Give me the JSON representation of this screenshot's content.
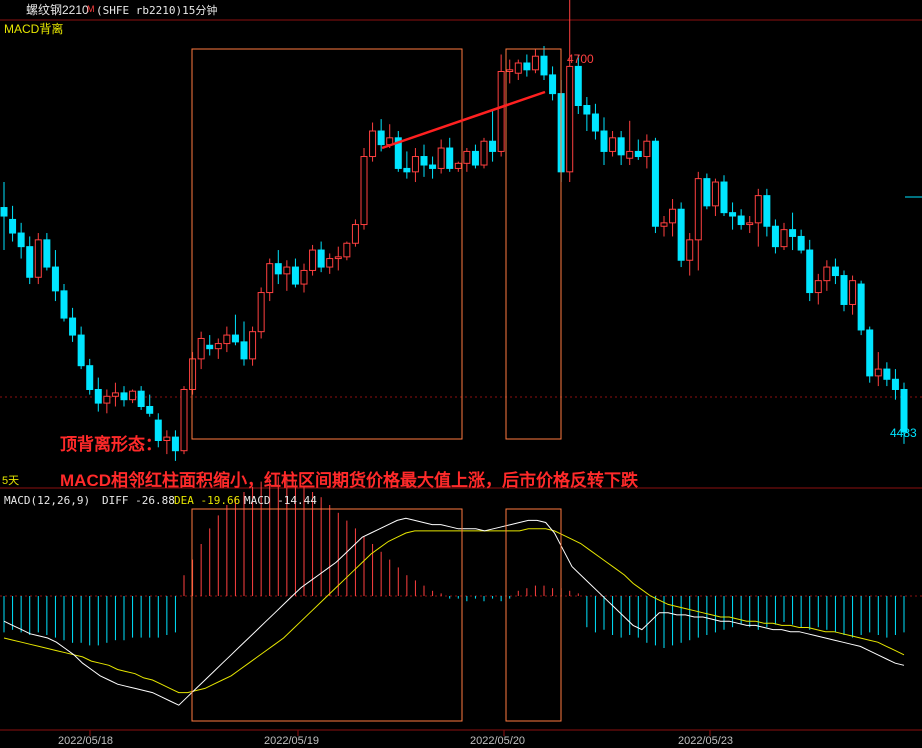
{
  "header": {
    "instrument": "螺纹钢2210",
    "flag": "M",
    "info": "(SHFE rb2210)15分钟"
  },
  "price_panel": {
    "indicator_title": "MACD背离",
    "period_label": "5天",
    "high_label": "4700",
    "last_label": "4483"
  },
  "macd_panel": {
    "title": "MACD(12,26,9)",
    "diff_label": "DIFF -26.88",
    "dea_label": "DEA -19.66",
    "macd_label": "MACD -14.44"
  },
  "annotation": {
    "line1": "顶背离形态：",
    "line2": "MACD相邻红柱面积缩小，红柱区间期货价格最大值上涨，后市价格反转下跌"
  },
  "colors": {
    "up": "#ff4040",
    "down": "#00e5ff",
    "box": "#ff7a40",
    "diff": "#ffffff",
    "dea": "#e6e600",
    "divergence_line": "#ff2020",
    "grid": "#8b1010"
  },
  "chart_data": {
    "type": "candlestick",
    "x_ticks": [
      "2022/05/18",
      "2022/05/19",
      "2022/05/20",
      "2022/05/23"
    ],
    "price_high": 4700,
    "price_last": 4483,
    "candles": [
      {
        "o": 4615,
        "h": 4630,
        "l": 4590,
        "c": 4610
      },
      {
        "o": 4608,
        "h": 4616,
        "l": 4595,
        "c": 4600
      },
      {
        "o": 4600,
        "h": 4606,
        "l": 4585,
        "c": 4592
      },
      {
        "o": 4592,
        "h": 4598,
        "l": 4570,
        "c": 4574
      },
      {
        "o": 4574,
        "h": 4600,
        "l": 4570,
        "c": 4596
      },
      {
        "o": 4596,
        "h": 4600,
        "l": 4578,
        "c": 4580
      },
      {
        "o": 4580,
        "h": 4590,
        "l": 4560,
        "c": 4566
      },
      {
        "o": 4566,
        "h": 4570,
        "l": 4548,
        "c": 4550
      },
      {
        "o": 4550,
        "h": 4556,
        "l": 4536,
        "c": 4540
      },
      {
        "o": 4540,
        "h": 4545,
        "l": 4520,
        "c": 4522
      },
      {
        "o": 4522,
        "h": 4526,
        "l": 4505,
        "c": 4508
      },
      {
        "o": 4508,
        "h": 4515,
        "l": 4495,
        "c": 4500
      },
      {
        "o": 4500,
        "h": 4508,
        "l": 4494,
        "c": 4504
      },
      {
        "o": 4504,
        "h": 4512,
        "l": 4498,
        "c": 4506
      },
      {
        "o": 4506,
        "h": 4510,
        "l": 4498,
        "c": 4502
      },
      {
        "o": 4502,
        "h": 4508,
        "l": 4500,
        "c": 4507
      },
      {
        "o": 4507,
        "h": 4510,
        "l": 4496,
        "c": 4498
      },
      {
        "o": 4498,
        "h": 4505,
        "l": 4492,
        "c": 4494
      },
      {
        "o": 4490,
        "h": 4494,
        "l": 4474,
        "c": 4478
      },
      {
        "o": 4478,
        "h": 4484,
        "l": 4470,
        "c": 4480
      },
      {
        "o": 4480,
        "h": 4484,
        "l": 4466,
        "c": 4472
      },
      {
        "o": 4472,
        "h": 4510,
        "l": 4470,
        "c": 4508
      },
      {
        "o": 4508,
        "h": 4530,
        "l": 4505,
        "c": 4526
      },
      {
        "o": 4526,
        "h": 4542,
        "l": 4520,
        "c": 4538
      },
      {
        "o": 4534,
        "h": 4540,
        "l": 4528,
        "c": 4532
      },
      {
        "o": 4532,
        "h": 4538,
        "l": 4526,
        "c": 4535
      },
      {
        "o": 4535,
        "h": 4545,
        "l": 4530,
        "c": 4540
      },
      {
        "o": 4540,
        "h": 4552,
        "l": 4534,
        "c": 4536
      },
      {
        "o": 4536,
        "h": 4548,
        "l": 4522,
        "c": 4526
      },
      {
        "o": 4526,
        "h": 4545,
        "l": 4522,
        "c": 4542
      },
      {
        "o": 4542,
        "h": 4568,
        "l": 4538,
        "c": 4565
      },
      {
        "o": 4565,
        "h": 4585,
        "l": 4560,
        "c": 4582
      },
      {
        "o": 4582,
        "h": 4590,
        "l": 4570,
        "c": 4576
      },
      {
        "o": 4576,
        "h": 4584,
        "l": 4566,
        "c": 4580
      },
      {
        "o": 4580,
        "h": 4585,
        "l": 4568,
        "c": 4570
      },
      {
        "o": 4570,
        "h": 4582,
        "l": 4565,
        "c": 4578
      },
      {
        "o": 4578,
        "h": 4593,
        "l": 4575,
        "c": 4590
      },
      {
        "o": 4590,
        "h": 4595,
        "l": 4577,
        "c": 4580
      },
      {
        "o": 4580,
        "h": 4588,
        "l": 4576,
        "c": 4585
      },
      {
        "o": 4585,
        "h": 4592,
        "l": 4578,
        "c": 4586
      },
      {
        "o": 4586,
        "h": 4595,
        "l": 4584,
        "c": 4594
      },
      {
        "o": 4594,
        "h": 4608,
        "l": 4592,
        "c": 4605
      },
      {
        "o": 4605,
        "h": 4650,
        "l": 4602,
        "c": 4645
      },
      {
        "o": 4645,
        "h": 4665,
        "l": 4642,
        "c": 4660
      },
      {
        "o": 4660,
        "h": 4667,
        "l": 4648,
        "c": 4652
      },
      {
        "o": 4652,
        "h": 4664,
        "l": 4650,
        "c": 4656
      },
      {
        "o": 4656,
        "h": 4660,
        "l": 4636,
        "c": 4638
      },
      {
        "o": 4638,
        "h": 4648,
        "l": 4632,
        "c": 4636
      },
      {
        "o": 4636,
        "h": 4650,
        "l": 4630,
        "c": 4645
      },
      {
        "o": 4645,
        "h": 4652,
        "l": 4633,
        "c": 4640
      },
      {
        "o": 4640,
        "h": 4645,
        "l": 4632,
        "c": 4638
      },
      {
        "o": 4638,
        "h": 4655,
        "l": 4635,
        "c": 4650
      },
      {
        "o": 4650,
        "h": 4656,
        "l": 4636,
        "c": 4638
      },
      {
        "o": 4638,
        "h": 4642,
        "l": 4636,
        "c": 4641
      },
      {
        "o": 4641,
        "h": 4650,
        "l": 4636,
        "c": 4648
      },
      {
        "o": 4648,
        "h": 4652,
        "l": 4638,
        "c": 4640
      },
      {
        "o": 4640,
        "h": 4656,
        "l": 4638,
        "c": 4654
      },
      {
        "o": 4654,
        "h": 4672,
        "l": 4642,
        "c": 4648
      },
      {
        "o": 4648,
        "h": 4705,
        "l": 4645,
        "c": 4695
      },
      {
        "o": 4695,
        "h": 4702,
        "l": 4688,
        "c": 4696
      },
      {
        "o": 4694,
        "h": 4702,
        "l": 4690,
        "c": 4700
      },
      {
        "o": 4700,
        "h": 4705,
        "l": 4692,
        "c": 4696
      },
      {
        "o": 4696,
        "h": 4708,
        "l": 4694,
        "c": 4704
      },
      {
        "o": 4704,
        "h": 4710,
        "l": 4690,
        "c": 4693
      },
      {
        "o": 4693,
        "h": 4698,
        "l": 4678,
        "c": 4682
      },
      {
        "o": 4682,
        "h": 4690,
        "l": 4630,
        "c": 4636
      },
      {
        "o": 4636,
        "h": 4740,
        "l": 4630,
        "c": 4698
      },
      {
        "o": 4698,
        "h": 4705,
        "l": 4670,
        "c": 4675
      },
      {
        "o": 4675,
        "h": 4680,
        "l": 4660,
        "c": 4670
      },
      {
        "o": 4670,
        "h": 4676,
        "l": 4655,
        "c": 4660
      },
      {
        "o": 4660,
        "h": 4668,
        "l": 4640,
        "c": 4648
      },
      {
        "o": 4648,
        "h": 4660,
        "l": 4645,
        "c": 4656
      },
      {
        "o": 4656,
        "h": 4660,
        "l": 4640,
        "c": 4646
      },
      {
        "o": 4644,
        "h": 4666,
        "l": 4640,
        "c": 4648
      },
      {
        "o": 4648,
        "h": 4655,
        "l": 4643,
        "c": 4645
      },
      {
        "o": 4645,
        "h": 4658,
        "l": 4638,
        "c": 4654
      },
      {
        "o": 4654,
        "h": 4656,
        "l": 4600,
        "c": 4604
      },
      {
        "o": 4604,
        "h": 4610,
        "l": 4598,
        "c": 4606
      },
      {
        "o": 4606,
        "h": 4620,
        "l": 4598,
        "c": 4614
      },
      {
        "o": 4614,
        "h": 4618,
        "l": 4580,
        "c": 4584
      },
      {
        "o": 4584,
        "h": 4600,
        "l": 4575,
        "c": 4596
      },
      {
        "o": 4596,
        "h": 4636,
        "l": 4578,
        "c": 4632
      },
      {
        "o": 4632,
        "h": 4635,
        "l": 4614,
        "c": 4616
      },
      {
        "o": 4616,
        "h": 4632,
        "l": 4610,
        "c": 4630
      },
      {
        "o": 4630,
        "h": 4634,
        "l": 4610,
        "c": 4612
      },
      {
        "o": 4612,
        "h": 4618,
        "l": 4602,
        "c": 4610
      },
      {
        "o": 4610,
        "h": 4614,
        "l": 4602,
        "c": 4605
      },
      {
        "o": 4605,
        "h": 4610,
        "l": 4600,
        "c": 4606
      },
      {
        "o": 4606,
        "h": 4626,
        "l": 4592,
        "c": 4622
      },
      {
        "o": 4622,
        "h": 4626,
        "l": 4598,
        "c": 4604
      },
      {
        "o": 4604,
        "h": 4608,
        "l": 4588,
        "c": 4592
      },
      {
        "o": 4592,
        "h": 4606,
        "l": 4590,
        "c": 4602
      },
      {
        "o": 4602,
        "h": 4612,
        "l": 4590,
        "c": 4598
      },
      {
        "o": 4598,
        "h": 4602,
        "l": 4588,
        "c": 4590
      },
      {
        "o": 4590,
        "h": 4596,
        "l": 4560,
        "c": 4565
      },
      {
        "o": 4565,
        "h": 4576,
        "l": 4558,
        "c": 4572
      },
      {
        "o": 4572,
        "h": 4584,
        "l": 4566,
        "c": 4580
      },
      {
        "o": 4580,
        "h": 4585,
        "l": 4570,
        "c": 4575
      },
      {
        "o": 4575,
        "h": 4578,
        "l": 4554,
        "c": 4558
      },
      {
        "o": 4558,
        "h": 4575,
        "l": 4552,
        "c": 4572
      },
      {
        "o": 4570,
        "h": 4572,
        "l": 4540,
        "c": 4543
      },
      {
        "o": 4543,
        "h": 4545,
        "l": 4512,
        "c": 4516
      },
      {
        "o": 4516,
        "h": 4530,
        "l": 4510,
        "c": 4520
      },
      {
        "o": 4520,
        "h": 4524,
        "l": 4510,
        "c": 4514
      },
      {
        "o": 4514,
        "h": 4520,
        "l": 4502,
        "c": 4508
      },
      {
        "o": 4508,
        "h": 4512,
        "l": 4476,
        "c": 4483
      }
    ],
    "macd": {
      "x_ticks": [
        "2022/05/18",
        "2022/05/19",
        "2022/05/20",
        "2022/05/23"
      ],
      "diff_last": -26.88,
      "dea_last": -19.66,
      "macd_last": -14.44,
      "histogram": [
        -14,
        -13,
        -14,
        -15,
        -14,
        -15,
        -16,
        -17,
        -18,
        -18,
        -19,
        -19,
        -18,
        -17,
        -17,
        -16,
        -16,
        -16,
        -16,
        -15,
        -14,
        8,
        14,
        20,
        26,
        31,
        35,
        38,
        40,
        42,
        44,
        45,
        46,
        46,
        44,
        42,
        40,
        38,
        35,
        32,
        29,
        26,
        23,
        20,
        17,
        14,
        11,
        8,
        6,
        4,
        2,
        1,
        -1,
        -1,
        -2,
        -1,
        -2,
        -1,
        -2,
        -1,
        2,
        3,
        4,
        4,
        3,
        3,
        2,
        1,
        -12,
        -14,
        -13,
        -15,
        -16,
        -15,
        -16,
        -18,
        -19,
        -20,
        -19,
        -18,
        -17,
        -16,
        -15,
        -14,
        -13,
        -12,
        -11,
        -12,
        -13,
        -12,
        -11,
        -10,
        -11,
        -12,
        -13,
        -12,
        -13,
        -14,
        -15,
        -16,
        -15,
        -14,
        -15,
        -16,
        -15,
        -14
      ],
      "diff": [
        -12,
        -14,
        -16,
        -18,
        -19,
        -20,
        -22,
        -25,
        -28,
        -32,
        -35,
        -38,
        -40,
        -42,
        -43,
        -44,
        -45,
        -46,
        -48,
        -50,
        -52,
        -48,
        -44,
        -40,
        -36,
        -32,
        -28,
        -24,
        -20,
        -16,
        -12,
        -8,
        -4,
        0,
        4,
        7,
        10,
        13,
        16,
        20,
        24,
        28,
        30,
        32,
        34,
        36,
        37,
        36,
        35,
        34,
        34,
        33,
        32,
        32,
        32,
        31,
        32,
        33,
        34,
        35,
        36,
        36,
        35,
        30,
        22,
        14,
        10,
        6,
        2,
        -2,
        -6,
        -10,
        -14,
        -16,
        -12,
        -8,
        -8,
        -9,
        -9,
        -10,
        -10,
        -11,
        -12,
        -12,
        -13,
        -14,
        -14,
        -15,
        -16,
        -16,
        -17,
        -17,
        -18,
        -19,
        -20,
        -21,
        -22,
        -23,
        -24,
        -26,
        -28,
        -30,
        -32,
        -33
      ],
      "dea": [
        -20,
        -21,
        -22,
        -23,
        -24,
        -25,
        -26,
        -27,
        -28,
        -29,
        -31,
        -32,
        -33,
        -35,
        -36,
        -37,
        -39,
        -40,
        -42,
        -44,
        -46,
        -46,
        -45,
        -44,
        -42,
        -40,
        -38,
        -35,
        -32,
        -29,
        -26,
        -23,
        -20,
        -16,
        -12,
        -8,
        -4,
        0,
        4,
        8,
        12,
        16,
        20,
        23,
        26,
        28,
        30,
        31,
        31,
        31,
        31,
        31,
        31,
        31,
        31,
        31,
        31,
        31,
        31,
        31,
        32,
        32,
        32,
        31,
        29,
        27,
        25,
        22,
        19,
        16,
        13,
        10,
        6,
        3,
        0,
        -2,
        -4,
        -5,
        -6,
        -7,
        -8,
        -9,
        -10,
        -10,
        -11,
        -12,
        -12,
        -13,
        -13,
        -14,
        -14,
        -15,
        -15,
        -16,
        -17,
        -17,
        -18,
        -19,
        -20,
        -21,
        -22,
        -24,
        -26,
        -28
      ]
    }
  }
}
